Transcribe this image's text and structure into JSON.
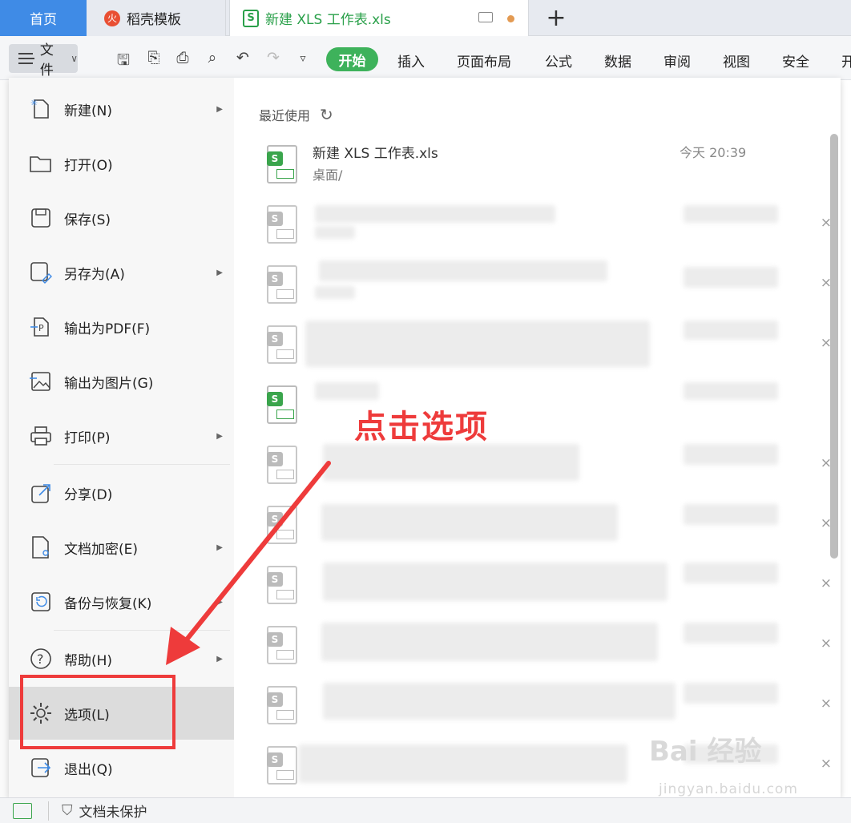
{
  "tabs": {
    "home": "首页",
    "template": "稻壳模板",
    "document": "新建 XLS 工作表.xls",
    "add": "+"
  },
  "toolbar": {
    "file_label": "文件",
    "ribbon": [
      "开始",
      "插入",
      "页面布局",
      "公式",
      "数据",
      "审阅",
      "视图",
      "安全",
      "开"
    ]
  },
  "menu": {
    "items": [
      {
        "label": "新建(N)",
        "icon": "new-file-icon",
        "submenu": true
      },
      {
        "label": "打开(O)",
        "icon": "folder-open-icon",
        "submenu": false
      },
      {
        "label": "保存(S)",
        "icon": "save-icon",
        "submenu": false
      },
      {
        "label": "另存为(A)",
        "icon": "save-as-icon",
        "submenu": true
      },
      {
        "label": "输出为PDF(F)",
        "icon": "export-pdf-icon",
        "submenu": false
      },
      {
        "label": "输出为图片(G)",
        "icon": "export-image-icon",
        "submenu": false
      },
      {
        "label": "打印(P)",
        "icon": "print-icon",
        "submenu": true
      },
      {
        "label": "分享(D)",
        "icon": "share-icon",
        "submenu": false
      },
      {
        "label": "文档加密(E)",
        "icon": "encrypt-icon",
        "submenu": true
      },
      {
        "label": "备份与恢复(K)",
        "icon": "backup-icon",
        "submenu": true
      },
      {
        "label": "帮助(H)",
        "icon": "help-icon",
        "submenu": true
      },
      {
        "label": "选项(L)",
        "icon": "gear-icon",
        "submenu": false
      },
      {
        "label": "退出(Q)",
        "icon": "exit-icon",
        "submenu": false
      }
    ]
  },
  "recent": {
    "heading": "最近使用",
    "first": {
      "name": "新建 XLS 工作表.xls",
      "path": "桌面/",
      "time": "今天 20:39"
    }
  },
  "annotation": {
    "text": "点击选项"
  },
  "status": {
    "protection": "文档未保护"
  },
  "watermark": {
    "brand": "Bai 经验",
    "url": "jingyan.baidu.com"
  },
  "colors": {
    "accent_green": "#3eb25b",
    "home_tab": "#3f8be6",
    "annotation_red": "#ee3b3b"
  }
}
